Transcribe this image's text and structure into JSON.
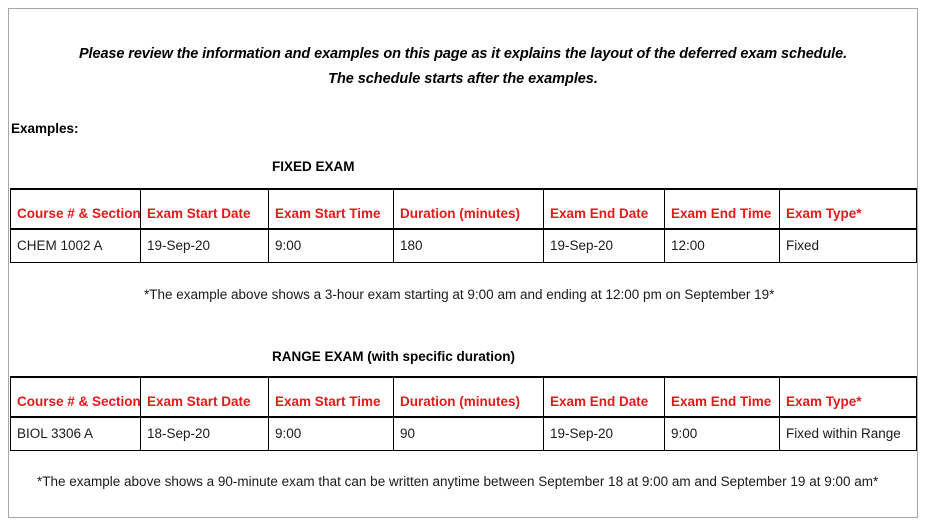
{
  "document": {
    "intro_line_1": "Please review the information and examples on this page as it explains the layout of the deferred exam schedule.",
    "intro_line_2": "The schedule starts after the examples.",
    "examples_label": "Examples:",
    "accent_color": "#e01b1b",
    "text_color": "#000000",
    "border_color": "#000000"
  },
  "columns": [
    "Course # & Section",
    "Exam Start Date",
    "Exam Start Time",
    "Duration (minutes)",
    "Exam End Date",
    "Exam End Time",
    "Exam Type*"
  ],
  "sections": [
    {
      "caption": "FIXED EXAM",
      "rows": [
        {
          "course": "CHEM 1002 A",
          "start_date": "19-Sep-20",
          "start_time": "9:00",
          "duration": "180",
          "end_date": "19-Sep-20",
          "end_time": "12:00",
          "exam_type": "Fixed"
        }
      ],
      "footnote": "*The example above shows a 3-hour exam starting at 9:00 am and ending at 12:00 pm on September 19*"
    },
    {
      "caption": "RANGE EXAM (with specific duration)",
      "rows": [
        {
          "course": "BIOL 3306 A",
          "start_date": "18-Sep-20",
          "start_time": "9:00",
          "duration": "90",
          "end_date": "19-Sep-20",
          "end_time": "9:00",
          "exam_type": "Fixed within Range"
        }
      ],
      "footnote": "*The example above shows a 90-minute exam that can be written anytime between September 18 at 9:00 am and September 19 at 9:00 am*"
    }
  ]
}
